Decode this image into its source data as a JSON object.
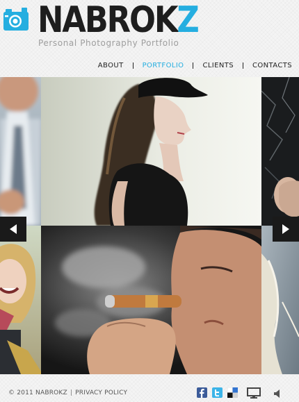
{
  "brand": {
    "logo_main": "NABROK",
    "logo_accent": "Z",
    "tagline": "Personal Photography Portfolio"
  },
  "nav": {
    "items": [
      {
        "label": "ABOUT",
        "active": false
      },
      {
        "label": "PORTFOLIO",
        "active": true
      },
      {
        "label": "CLIENTS",
        "active": false
      },
      {
        "label": "CONTACTS",
        "active": false
      }
    ]
  },
  "gallery": {
    "photos": [
      "man-in-tie-blurred",
      "woman-in-black-cap",
      "hand-on-dark-wall",
      "smiling-woman-blonde",
      "man-smoking-cigar",
      "woman-blonde-hair-profile"
    ]
  },
  "footer": {
    "copyright": "© 2011 NABROKZ",
    "separator": "|",
    "privacy": "PRIVACY POLICY"
  },
  "social": [
    "facebook-icon",
    "twitter-icon",
    "delicious-icon"
  ],
  "controls": [
    "slideshow-screen-icon",
    "sound-icon"
  ],
  "colors": {
    "accent": "#25aee0",
    "dark": "#1e1e1e",
    "background": "#f4f4f4"
  }
}
